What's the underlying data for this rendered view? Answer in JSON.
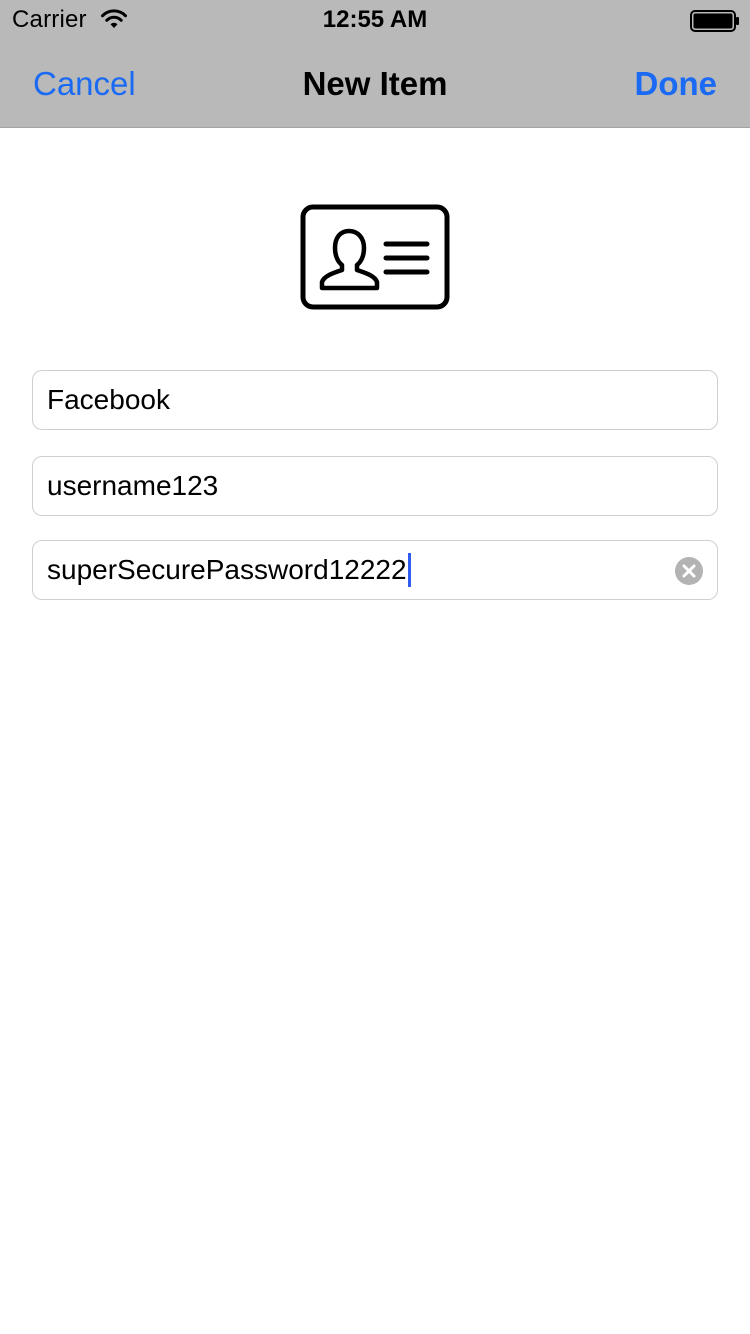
{
  "status_bar": {
    "carrier": "Carrier",
    "time": "12:55 AM",
    "wifi_icon": "wifi-icon",
    "battery_icon": "battery-icon"
  },
  "nav": {
    "cancel_label": "Cancel",
    "title": "New Item",
    "done_label": "Done"
  },
  "header_icon": "contact-card-icon",
  "form": {
    "name_value": "Facebook",
    "username_value": "username123",
    "password_value": "superSecurePassword12222",
    "clear_icon": "clear-icon"
  },
  "colors": {
    "accent": "#1a6af4",
    "bar_background": "#b9b9b9",
    "cursor": "#2f5bf0"
  }
}
